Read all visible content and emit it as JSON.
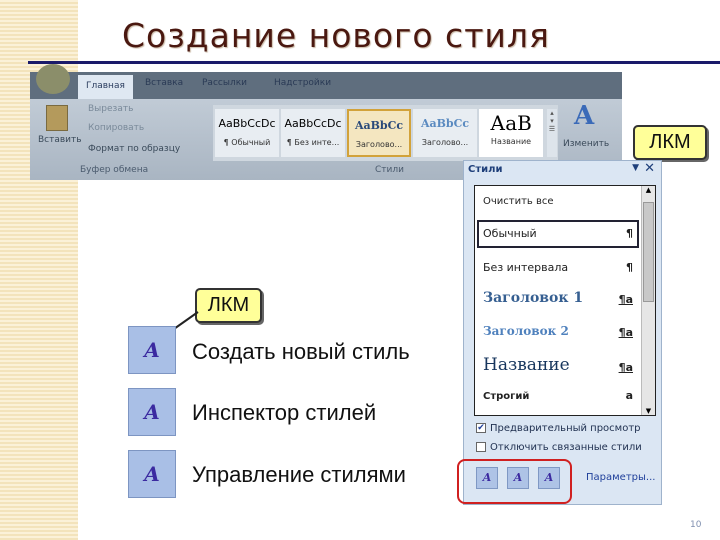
{
  "title": "Создание нового стиля",
  "ribbon": {
    "tabs": [
      "Главная",
      "Вставка",
      "Рассылки",
      "Надстройки"
    ],
    "clipboard": {
      "paste": "Вставить",
      "cut": "Вырезать",
      "copy": "Копировать",
      "format_painter": "Формат по образцу",
      "group": "Буфер обмена"
    },
    "styles": [
      {
        "preview": "AaBbCcDc",
        "name": "¶ Обычный"
      },
      {
        "preview": "AaBbCcDc",
        "name": "¶ Без инте..."
      },
      {
        "preview": "AaBbCc",
        "name": "Заголово..."
      },
      {
        "preview": "AaBbCc",
        "name": "Заголово..."
      },
      {
        "preview": "АаВ",
        "name": "Название"
      }
    ],
    "styles_group": "Стили",
    "change": "Изменить"
  },
  "callouts": {
    "top": "ЛКМ",
    "left": "ЛКМ"
  },
  "pane": {
    "title": "Стили",
    "items": [
      {
        "label": "Очистить все",
        "mark": ""
      },
      {
        "label": "Обычный",
        "mark": "¶"
      },
      {
        "label": "Без интервала",
        "mark": "¶"
      },
      {
        "label": "Заголовок 1",
        "mark": "¶a"
      },
      {
        "label": "Заголовок 2",
        "mark": "¶a"
      },
      {
        "label": "Название",
        "mark": "¶a"
      },
      {
        "label": "Строгий",
        "mark": "a"
      }
    ],
    "preview": "Предварительный просмотр",
    "preview_checked": true,
    "disable_linked": "Отключить связанные стили",
    "disable_linked_checked": false,
    "options": "Параметры..."
  },
  "actions": [
    "Создать новый стиль",
    "Инспектор стилей",
    "Управление стилями"
  ],
  "page_number": "10"
}
